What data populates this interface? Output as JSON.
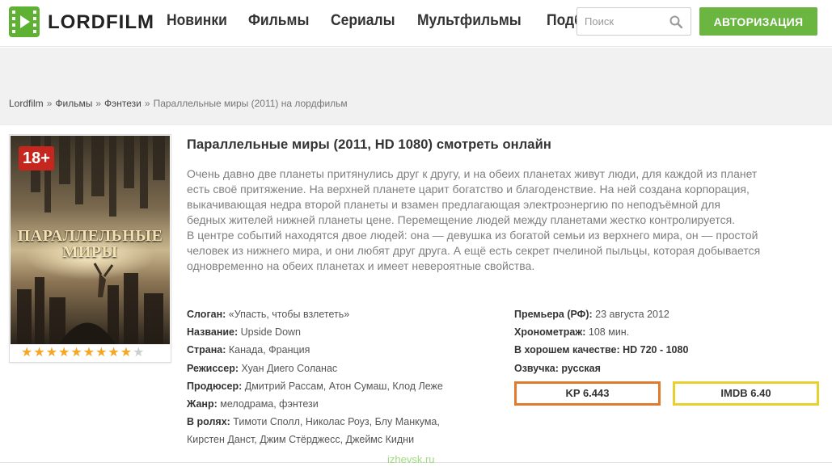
{
  "colors": {
    "accent": "#6ab640",
    "kp_border": "#e07a2f",
    "imdb_border": "#e8d12f",
    "age_badge": "#c5261e"
  },
  "header": {
    "logo_text": "LORDFILM",
    "nav": [
      "Новинки",
      "Фильмы",
      "Сериалы",
      "Мультфильмы",
      "Подборки"
    ],
    "search_placeholder": "Поиск",
    "auth_label": "АВТОРИЗАЦИЯ"
  },
  "breadcrumb": {
    "items": [
      "Lordfilm",
      "Фильмы",
      "Фэнтези"
    ],
    "separator": "»",
    "current": "Параллельные миры (2011) на лордфильм"
  },
  "movie": {
    "age_rating": "18+",
    "poster_title_line1": "ПАРАЛЛЕЛЬНЫЕ",
    "poster_title_line2": "МИРЫ",
    "user_rating": {
      "value": 9,
      "max": 10
    },
    "title": "Параллельные миры (2011, HD 1080) смотреть онлайн",
    "description_p1": "Очень давно две планеты притянулись друг к другу, и на обеих планетах живут люди, для каждой из планет есть своё притяжение. На верхней планете царит богатство и благоденствие. На ней создана корпорация, выкачивающая недра второй планеты и взамен предлагающая электроэнергию по неподъёмной для бедных жителей нижней планеты цене. Перемещение людей между планетами жестко контролируется.",
    "description_p2": "В центре событий находятся двое людей: она — девушка из богатой семьи из верхнего мира, он — простой человек из нижнего мира, и они любят друг друга. А ещё есть секрет пчелиной пыльцы, которая добывается одновременно на обеих планетах и имеет невероятные свойства.",
    "info": {
      "slogan_label": "Слоган:",
      "slogan": "«Упасть, чтобы взлететь»",
      "name_label": "Название:",
      "name": "Upside Down",
      "country_label": "Страна:",
      "country": "Канада, Франция",
      "director_label": "Режиссер:",
      "director": "Хуан Диего Соланас",
      "producer_label": "Продюсер:",
      "producer": "Дмитрий Рассам, Атон Сумаш, Клод Леже",
      "genre_label": "Жанр:",
      "genre": "мелодрама, фэнтези",
      "cast_label": "В ролях:",
      "cast_line1": "Тимоти Сполл, Николас Роуз, Блу Манкума,",
      "cast_line2": "Кирстен Данст, Джим Стёрджесс, Джеймс Кидни"
    },
    "info2": {
      "premiere_label": "Премьера (РФ):",
      "premiere": "23 августа 2012",
      "duration_label": "Хронометраж:",
      "duration": "108 мин.",
      "quality_label": "В хорошем качестве:",
      "quality": "HD 720 - 1080",
      "voice_label": "Озвучка:",
      "voice": "русская"
    },
    "kp_rating": "KP 6.443",
    "imdb_rating": "IMDB 6.40"
  },
  "watermark": "izhevsk.ru"
}
